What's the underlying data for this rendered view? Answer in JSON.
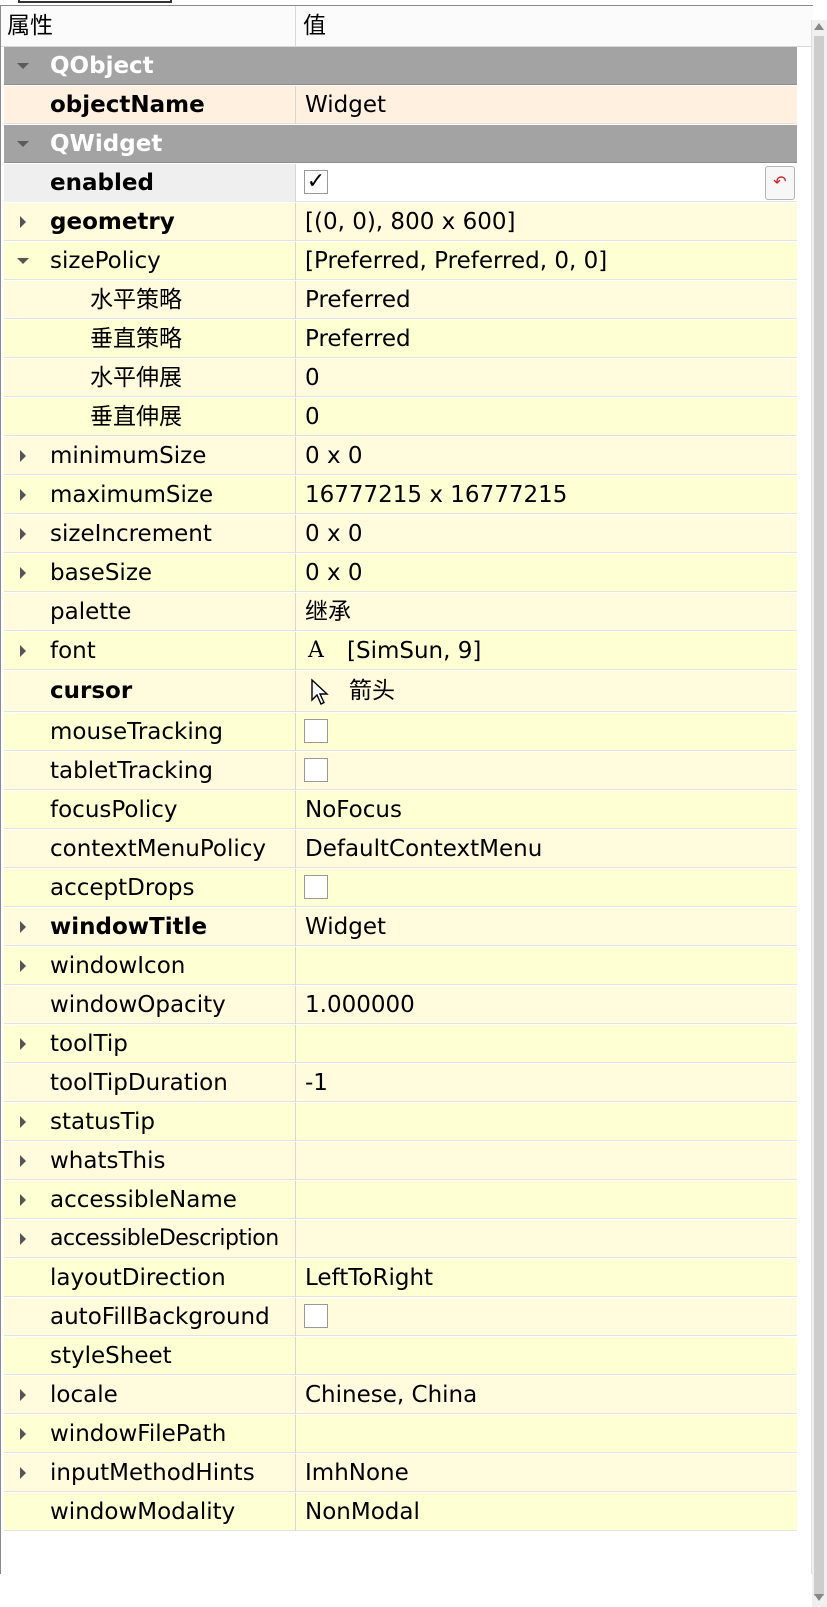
{
  "header": {
    "property": "属性",
    "value": "值"
  },
  "groups": {
    "qobject": "QObject",
    "qwidget": "QWidget"
  },
  "rows": {
    "objectName": {
      "name": "objectName",
      "value": "Widget"
    },
    "enabled": {
      "name": "enabled",
      "checked": true,
      "check": "✓"
    },
    "geometry": {
      "name": "geometry",
      "value": "[(0, 0), 800 x 600]"
    },
    "sizePolicy": {
      "name": "sizePolicy",
      "value": "[Preferred, Preferred, 0, 0]"
    },
    "hpolicy": {
      "name": "水平策略",
      "value": "Preferred"
    },
    "vpolicy": {
      "name": "垂直策略",
      "value": "Preferred"
    },
    "hstretch": {
      "name": "水平伸展",
      "value": "0"
    },
    "vstretch": {
      "name": "垂直伸展",
      "value": "0"
    },
    "minimumSize": {
      "name": "minimumSize",
      "value": "0 x 0"
    },
    "maximumSize": {
      "name": "maximumSize",
      "value": "16777215 x 16777215"
    },
    "sizeIncrement": {
      "name": "sizeIncrement",
      "value": "0 x 0"
    },
    "baseSize": {
      "name": "baseSize",
      "value": "0 x 0"
    },
    "palette": {
      "name": "palette",
      "value": "继承"
    },
    "font": {
      "name": "font",
      "value": "[SimSun, 9]",
      "icon": "A"
    },
    "cursor": {
      "name": "cursor",
      "value": "箭头"
    },
    "mouseTracking": {
      "name": "mouseTracking",
      "checked": false
    },
    "tabletTracking": {
      "name": "tabletTracking",
      "checked": false
    },
    "focusPolicy": {
      "name": "focusPolicy",
      "value": "NoFocus"
    },
    "contextMenuPolicy": {
      "name": "contextMenuPolicy",
      "value": "DefaultContextMenu"
    },
    "acceptDrops": {
      "name": "acceptDrops",
      "checked": false
    },
    "windowTitle": {
      "name": "windowTitle",
      "value": "Widget"
    },
    "windowIcon": {
      "name": "windowIcon",
      "value": ""
    },
    "windowOpacity": {
      "name": "windowOpacity",
      "value": "1.000000"
    },
    "toolTip": {
      "name": "toolTip",
      "value": ""
    },
    "toolTipDuration": {
      "name": "toolTipDuration",
      "value": "-1"
    },
    "statusTip": {
      "name": "statusTip",
      "value": ""
    },
    "whatsThis": {
      "name": "whatsThis",
      "value": ""
    },
    "accessibleName": {
      "name": "accessibleName",
      "value": ""
    },
    "accessibleDescription": {
      "name": "accessibleDescription",
      "value": ""
    },
    "layoutDirection": {
      "name": "layoutDirection",
      "value": "LeftToRight"
    },
    "autoFillBackground": {
      "name": "autoFillBackground",
      "checked": false
    },
    "styleSheet": {
      "name": "styleSheet",
      "value": ""
    },
    "locale": {
      "name": "locale",
      "value": "Chinese, China"
    },
    "windowFilePath": {
      "name": "windowFilePath",
      "value": ""
    },
    "inputMethodHints": {
      "name": "inputMethodHints",
      "value": "ImhNone"
    },
    "windowModality": {
      "name": "windowModality",
      "value": "NonModal"
    }
  },
  "colors": {
    "group_bg": "#a3a3a3",
    "row_yellow": "#fffbdc",
    "selected_row": "#fff0e0",
    "reset_icon": "#cc2222"
  },
  "icons": {
    "expand": "triangle-right-icon",
    "collapse": "triangle-down-icon",
    "reset": "reset-arrow-icon",
    "font": "font-a-icon",
    "cursor": "arrow-cursor-icon"
  }
}
